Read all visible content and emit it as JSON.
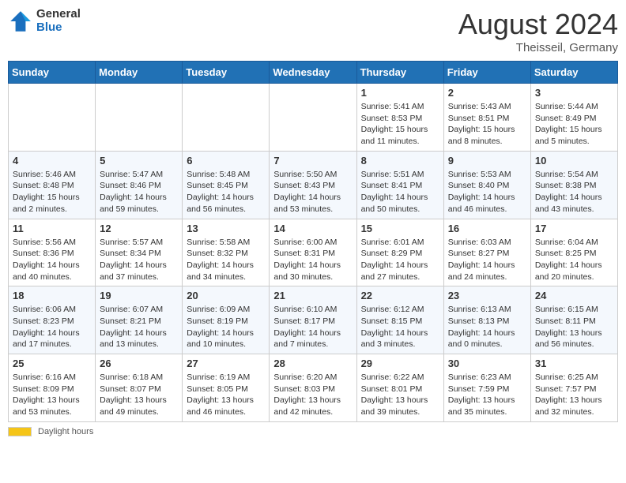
{
  "header": {
    "logo_general": "General",
    "logo_blue": "Blue",
    "month_year": "August 2024",
    "location": "Theisseil, Germany"
  },
  "weekdays": [
    "Sunday",
    "Monday",
    "Tuesday",
    "Wednesday",
    "Thursday",
    "Friday",
    "Saturday"
  ],
  "weeks": [
    [
      {
        "day": "",
        "sunrise": "",
        "sunset": "",
        "daylight": ""
      },
      {
        "day": "",
        "sunrise": "",
        "sunset": "",
        "daylight": ""
      },
      {
        "day": "",
        "sunrise": "",
        "sunset": "",
        "daylight": ""
      },
      {
        "day": "",
        "sunrise": "",
        "sunset": "",
        "daylight": ""
      },
      {
        "day": "1",
        "sunrise": "Sunrise: 5:41 AM",
        "sunset": "Sunset: 8:53 PM",
        "daylight": "Daylight: 15 hours and 11 minutes."
      },
      {
        "day": "2",
        "sunrise": "Sunrise: 5:43 AM",
        "sunset": "Sunset: 8:51 PM",
        "daylight": "Daylight: 15 hours and 8 minutes."
      },
      {
        "day": "3",
        "sunrise": "Sunrise: 5:44 AM",
        "sunset": "Sunset: 8:49 PM",
        "daylight": "Daylight: 15 hours and 5 minutes."
      }
    ],
    [
      {
        "day": "4",
        "sunrise": "Sunrise: 5:46 AM",
        "sunset": "Sunset: 8:48 PM",
        "daylight": "Daylight: 15 hours and 2 minutes."
      },
      {
        "day": "5",
        "sunrise": "Sunrise: 5:47 AM",
        "sunset": "Sunset: 8:46 PM",
        "daylight": "Daylight: 14 hours and 59 minutes."
      },
      {
        "day": "6",
        "sunrise": "Sunrise: 5:48 AM",
        "sunset": "Sunset: 8:45 PM",
        "daylight": "Daylight: 14 hours and 56 minutes."
      },
      {
        "day": "7",
        "sunrise": "Sunrise: 5:50 AM",
        "sunset": "Sunset: 8:43 PM",
        "daylight": "Daylight: 14 hours and 53 minutes."
      },
      {
        "day": "8",
        "sunrise": "Sunrise: 5:51 AM",
        "sunset": "Sunset: 8:41 PM",
        "daylight": "Daylight: 14 hours and 50 minutes."
      },
      {
        "day": "9",
        "sunrise": "Sunrise: 5:53 AM",
        "sunset": "Sunset: 8:40 PM",
        "daylight": "Daylight: 14 hours and 46 minutes."
      },
      {
        "day": "10",
        "sunrise": "Sunrise: 5:54 AM",
        "sunset": "Sunset: 8:38 PM",
        "daylight": "Daylight: 14 hours and 43 minutes."
      }
    ],
    [
      {
        "day": "11",
        "sunrise": "Sunrise: 5:56 AM",
        "sunset": "Sunset: 8:36 PM",
        "daylight": "Daylight: 14 hours and 40 minutes."
      },
      {
        "day": "12",
        "sunrise": "Sunrise: 5:57 AM",
        "sunset": "Sunset: 8:34 PM",
        "daylight": "Daylight: 14 hours and 37 minutes."
      },
      {
        "day": "13",
        "sunrise": "Sunrise: 5:58 AM",
        "sunset": "Sunset: 8:32 PM",
        "daylight": "Daylight: 14 hours and 34 minutes."
      },
      {
        "day": "14",
        "sunrise": "Sunrise: 6:00 AM",
        "sunset": "Sunset: 8:31 PM",
        "daylight": "Daylight: 14 hours and 30 minutes."
      },
      {
        "day": "15",
        "sunrise": "Sunrise: 6:01 AM",
        "sunset": "Sunset: 8:29 PM",
        "daylight": "Daylight: 14 hours and 27 minutes."
      },
      {
        "day": "16",
        "sunrise": "Sunrise: 6:03 AM",
        "sunset": "Sunset: 8:27 PM",
        "daylight": "Daylight: 14 hours and 24 minutes."
      },
      {
        "day": "17",
        "sunrise": "Sunrise: 6:04 AM",
        "sunset": "Sunset: 8:25 PM",
        "daylight": "Daylight: 14 hours and 20 minutes."
      }
    ],
    [
      {
        "day": "18",
        "sunrise": "Sunrise: 6:06 AM",
        "sunset": "Sunset: 8:23 PM",
        "daylight": "Daylight: 14 hours and 17 minutes."
      },
      {
        "day": "19",
        "sunrise": "Sunrise: 6:07 AM",
        "sunset": "Sunset: 8:21 PM",
        "daylight": "Daylight: 14 hours and 13 minutes."
      },
      {
        "day": "20",
        "sunrise": "Sunrise: 6:09 AM",
        "sunset": "Sunset: 8:19 PM",
        "daylight": "Daylight: 14 hours and 10 minutes."
      },
      {
        "day": "21",
        "sunrise": "Sunrise: 6:10 AM",
        "sunset": "Sunset: 8:17 PM",
        "daylight": "Daylight: 14 hours and 7 minutes."
      },
      {
        "day": "22",
        "sunrise": "Sunrise: 6:12 AM",
        "sunset": "Sunset: 8:15 PM",
        "daylight": "Daylight: 14 hours and 3 minutes."
      },
      {
        "day": "23",
        "sunrise": "Sunrise: 6:13 AM",
        "sunset": "Sunset: 8:13 PM",
        "daylight": "Daylight: 14 hours and 0 minutes."
      },
      {
        "day": "24",
        "sunrise": "Sunrise: 6:15 AM",
        "sunset": "Sunset: 8:11 PM",
        "daylight": "Daylight: 13 hours and 56 minutes."
      }
    ],
    [
      {
        "day": "25",
        "sunrise": "Sunrise: 6:16 AM",
        "sunset": "Sunset: 8:09 PM",
        "daylight": "Daylight: 13 hours and 53 minutes."
      },
      {
        "day": "26",
        "sunrise": "Sunrise: 6:18 AM",
        "sunset": "Sunset: 8:07 PM",
        "daylight": "Daylight: 13 hours and 49 minutes."
      },
      {
        "day": "27",
        "sunrise": "Sunrise: 6:19 AM",
        "sunset": "Sunset: 8:05 PM",
        "daylight": "Daylight: 13 hours and 46 minutes."
      },
      {
        "day": "28",
        "sunrise": "Sunrise: 6:20 AM",
        "sunset": "Sunset: 8:03 PM",
        "daylight": "Daylight: 13 hours and 42 minutes."
      },
      {
        "day": "29",
        "sunrise": "Sunrise: 6:22 AM",
        "sunset": "Sunset: 8:01 PM",
        "daylight": "Daylight: 13 hours and 39 minutes."
      },
      {
        "day": "30",
        "sunrise": "Sunrise: 6:23 AM",
        "sunset": "Sunset: 7:59 PM",
        "daylight": "Daylight: 13 hours and 35 minutes."
      },
      {
        "day": "31",
        "sunrise": "Sunrise: 6:25 AM",
        "sunset": "Sunset: 7:57 PM",
        "daylight": "Daylight: 13 hours and 32 minutes."
      }
    ]
  ],
  "footer": {
    "daylight_label": "Daylight hours"
  }
}
